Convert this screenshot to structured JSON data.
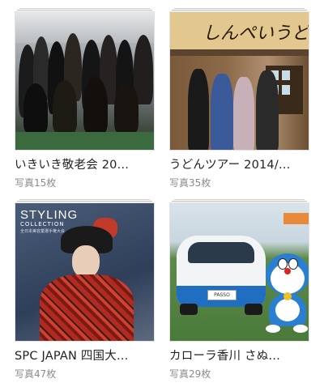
{
  "albums": [
    {
      "title": "いきいき敬老会 20…",
      "count": "写真15枚"
    },
    {
      "title": "うどんツアー 2014/…",
      "count": "写真35枚",
      "sign_text": "しんぺいうどん"
    },
    {
      "title": "SPC JAPAN 四国大…",
      "count": "写真47枚",
      "cover_heading": "STYLING",
      "cover_sub": "COLLECTION",
      "cover_caption": "全日本美容業選手権大会"
    },
    {
      "title": "カローラ香川 さぬ…",
      "count": "写真29枚",
      "plate_text": "PASSO"
    }
  ]
}
